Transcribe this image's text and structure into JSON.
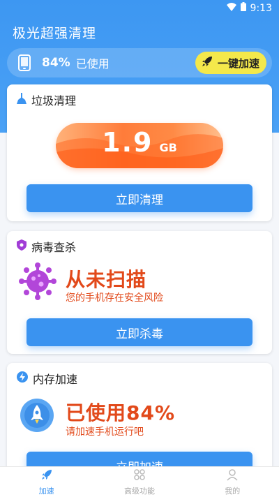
{
  "status_bar": {
    "time": "9:13"
  },
  "app": {
    "title": "极光超强清理"
  },
  "usage": {
    "percent": "84%",
    "label": "已使用",
    "boost_label": "一键加速"
  },
  "cards": {
    "junk": {
      "title": "垃圾清理",
      "value": "1.9",
      "unit": "GB",
      "button": "立即清理"
    },
    "virus": {
      "title": "病毒查杀",
      "status": "从未扫描",
      "subtitle": "您的手机存在安全风险",
      "button": "立即杀毒"
    },
    "memory": {
      "title": "内存加速",
      "status": "已使用84%",
      "subtitle": "请加速手机运行吧",
      "button": "立即加速"
    }
  },
  "nav": [
    {
      "label": "加速",
      "icon": "rocket-icon",
      "active": true
    },
    {
      "label": "高级功能",
      "icon": "grid-icon",
      "active": false
    },
    {
      "label": "我的",
      "icon": "user-icon",
      "active": false
    }
  ],
  "colors": {
    "primary": "#3a93f0",
    "accent": "#f4e84b",
    "warning": "#e2491a"
  }
}
